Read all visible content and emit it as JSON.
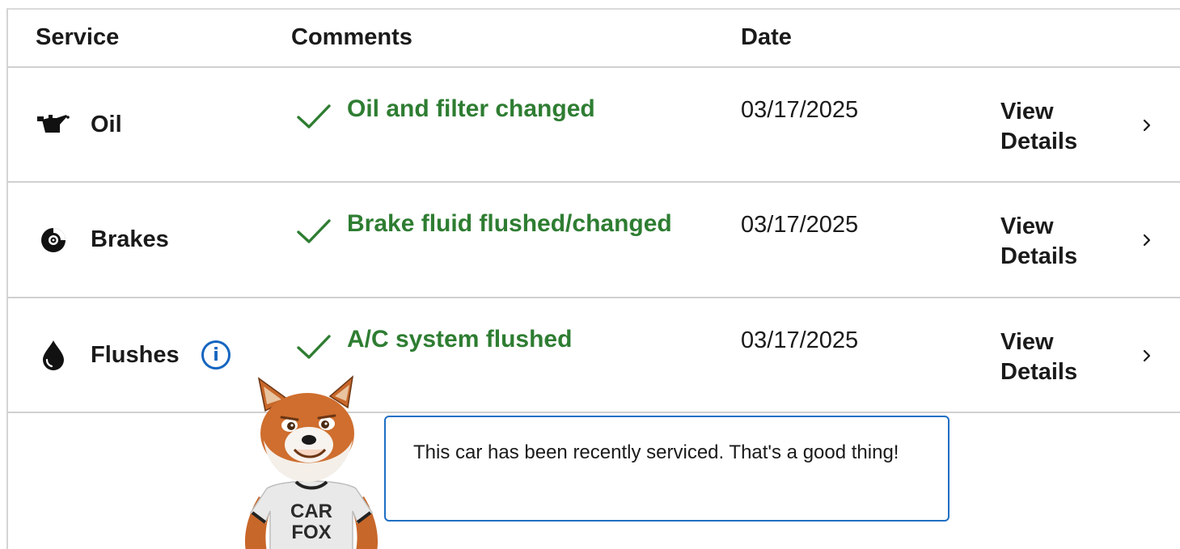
{
  "table": {
    "headers": {
      "service": "Service",
      "comments": "Comments",
      "date": "Date"
    },
    "rows": [
      {
        "service": "Oil",
        "icon": "oil-can-icon",
        "comment": "Oil and filter changed",
        "date": "03/17/2025",
        "details": "View Details"
      },
      {
        "service": "Brakes",
        "icon": "brake-disc-icon",
        "comment": "Brake fluid flushed/changed",
        "date": "03/17/2025",
        "details": "View Details"
      },
      {
        "service": "Flushes",
        "icon": "fluid-drop-icon",
        "comment": "A/C system flushed",
        "date": "03/17/2025",
        "details": "View Details",
        "info_icon": "info-icon"
      }
    ]
  },
  "mascot": {
    "shirt_text": "CAR FOX"
  },
  "tooltip": {
    "text": "This car has been recently serviced. That's a good thing!"
  },
  "colors": {
    "comment_green": "#2e7d32",
    "info_blue": "#1565c0",
    "tooltip_border": "#1f6fc4"
  }
}
